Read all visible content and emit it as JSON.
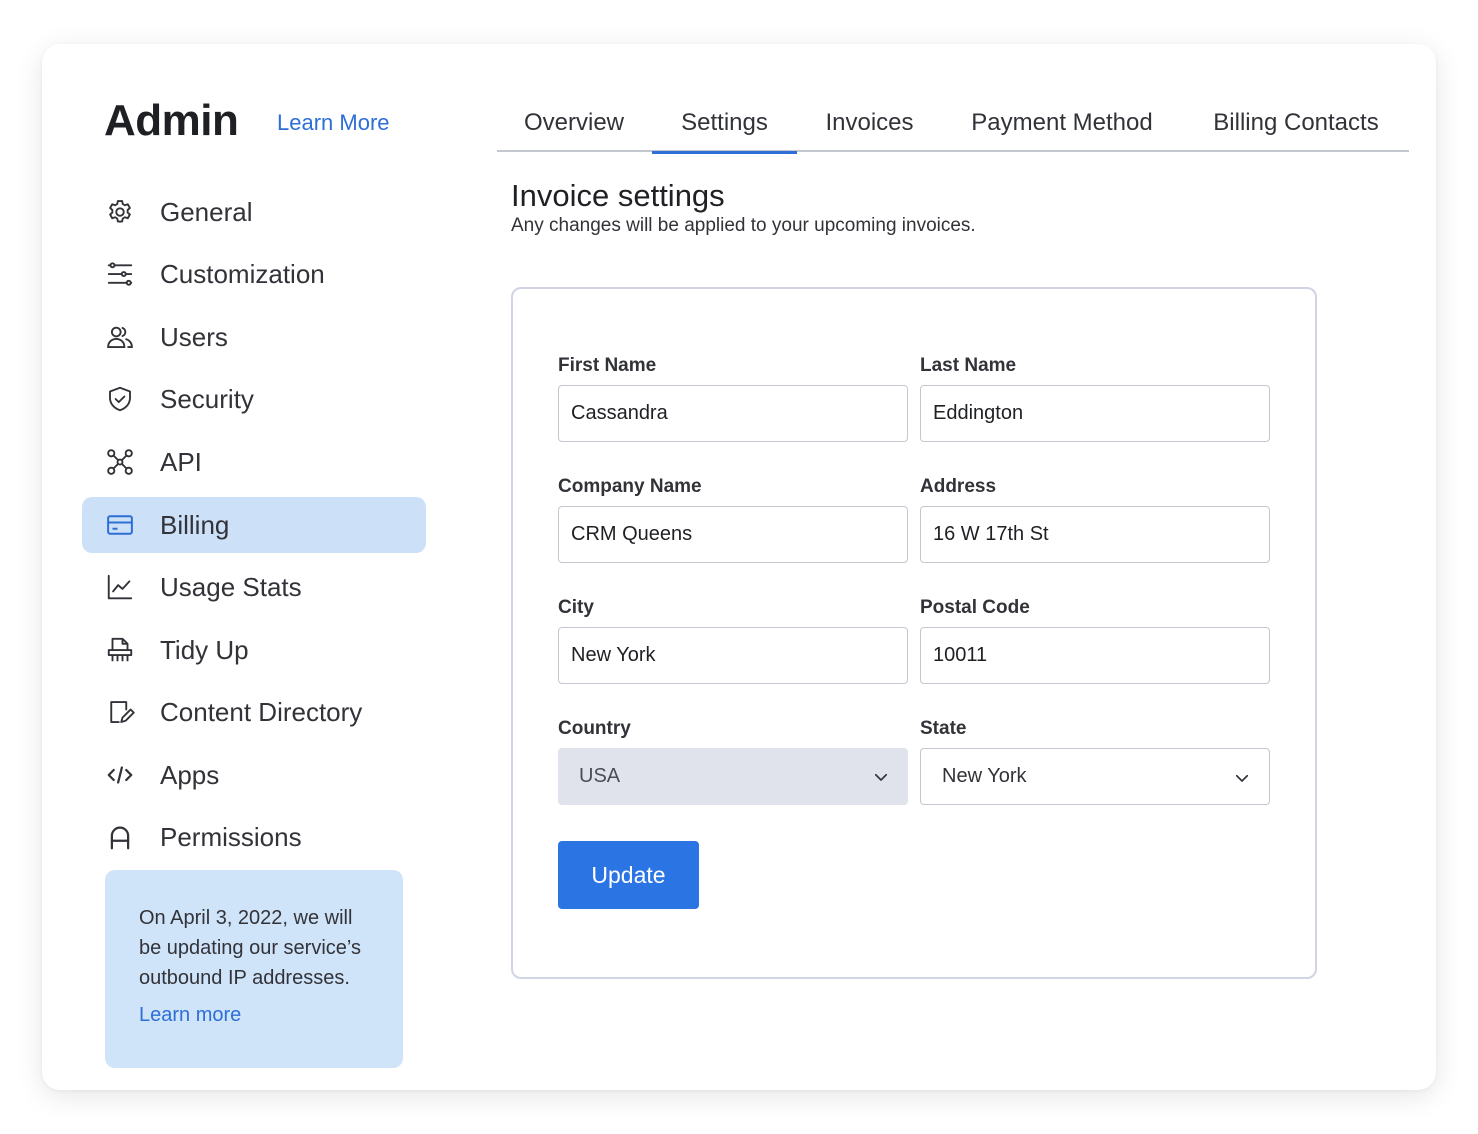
{
  "header": {
    "title": "Admin",
    "learn_more": "Learn More"
  },
  "sidebar": {
    "items": [
      {
        "label": "General",
        "icon": "gear-icon"
      },
      {
        "label": "Customization",
        "icon": "sliders-icon"
      },
      {
        "label": "Users",
        "icon": "users-icon"
      },
      {
        "label": "Security",
        "icon": "shield-icon"
      },
      {
        "label": "API",
        "icon": "api-nodes-icon"
      },
      {
        "label": "Billing",
        "icon": "credit-card-icon",
        "active": true
      },
      {
        "label": "Usage Stats",
        "icon": "line-chart-icon"
      },
      {
        "label": "Tidy Up",
        "icon": "shredder-icon"
      },
      {
        "label": "Content Directory",
        "icon": "document-edit-icon"
      },
      {
        "label": "Apps",
        "icon": "code-icon"
      },
      {
        "label": "Permissions",
        "icon": "lock-icon"
      }
    ],
    "notice": {
      "text": "On April 3, 2022, we will be updating our service’s outbound IP addresses.",
      "link": "Learn more"
    }
  },
  "tabs": [
    {
      "label": "Overview",
      "active": false
    },
    {
      "label": "Settings",
      "active": true
    },
    {
      "label": "Invoices",
      "active": false
    },
    {
      "label": "Payment Method",
      "active": false
    },
    {
      "label": "Billing Contacts",
      "active": false
    }
  ],
  "main": {
    "title": "Invoice settings",
    "subtitle": "Any changes will be applied to your upcoming invoices."
  },
  "form": {
    "first_name": {
      "label": "First Name",
      "value": "Cassandra"
    },
    "last_name": {
      "label": "Last Name",
      "value": "Eddington"
    },
    "company_name": {
      "label": "Company Name",
      "value": "CRM Queens"
    },
    "address": {
      "label": "Address",
      "value": "16 W 17th St"
    },
    "city": {
      "label": "City",
      "value": "New York"
    },
    "postal_code": {
      "label": "Postal Code",
      "value": "10011"
    },
    "country": {
      "label": "Country",
      "value": "USA",
      "disabled": true
    },
    "state": {
      "label": "State",
      "value": "New York"
    },
    "submit": "Update"
  },
  "colors": {
    "accent": "#2b74e4",
    "link": "#2d6fd6",
    "active_nav_bg": "#cce1f8",
    "notice_bg": "#cfe3f9"
  }
}
